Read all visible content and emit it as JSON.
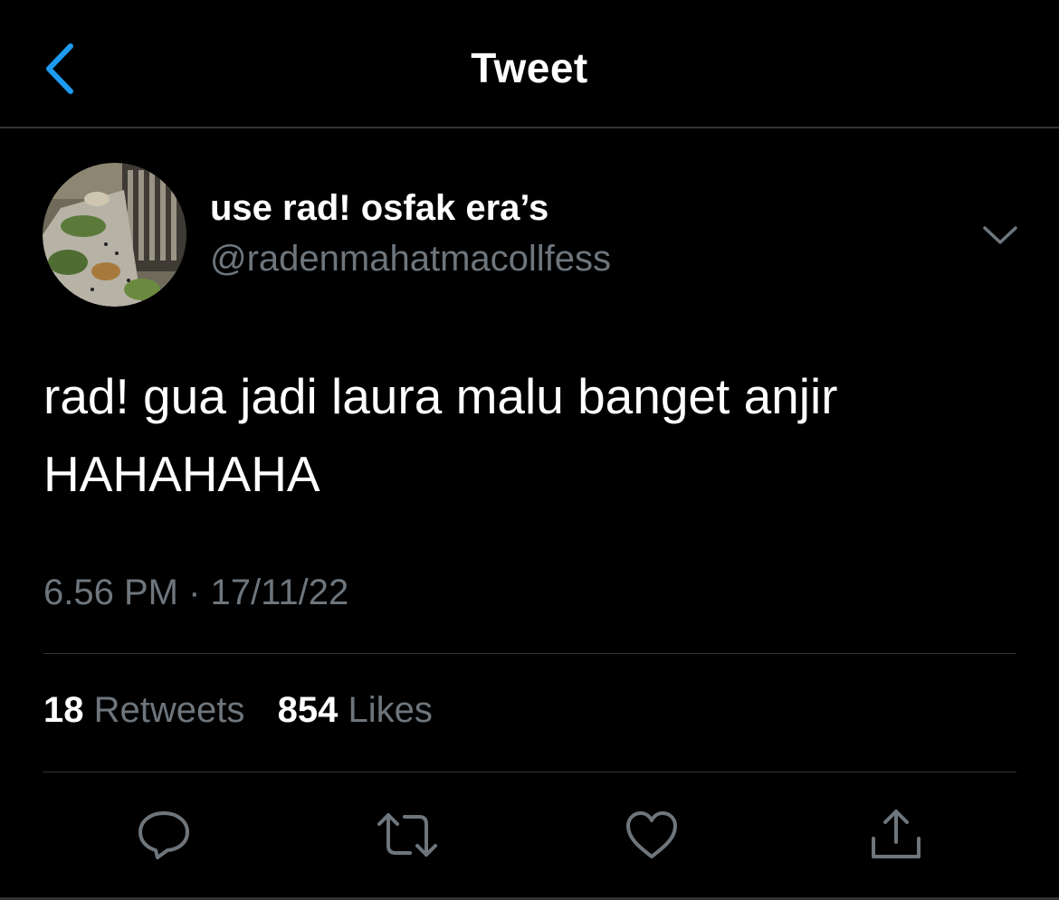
{
  "header": {
    "title": "Tweet",
    "back_icon": "chevron-left-icon"
  },
  "colors": {
    "background": "#000000",
    "text_primary": "#ffffff",
    "text_secondary": "#6e767d",
    "accent": "#1d9bf0",
    "divider": "#2f3336"
  },
  "tweet": {
    "author": {
      "display_name": "use rad! osfak era’s",
      "handle": "@radenmahatmacollfess",
      "avatar_icon": "avatar-photo"
    },
    "more_icon": "chevron-down-icon",
    "text_line1": "rad! gua jadi laura malu banget anjir",
    "text_line2": "HAHAHAHA",
    "timestamp": "6.56 PM · 17/11/22",
    "stats": {
      "retweets_count": "18",
      "retweets_label": "Retweets",
      "likes_count": "854",
      "likes_label": "Likes"
    },
    "actions": [
      {
        "icon": "reply-icon"
      },
      {
        "icon": "retweet-icon"
      },
      {
        "icon": "like-icon"
      },
      {
        "icon": "share-icon"
      }
    ]
  }
}
